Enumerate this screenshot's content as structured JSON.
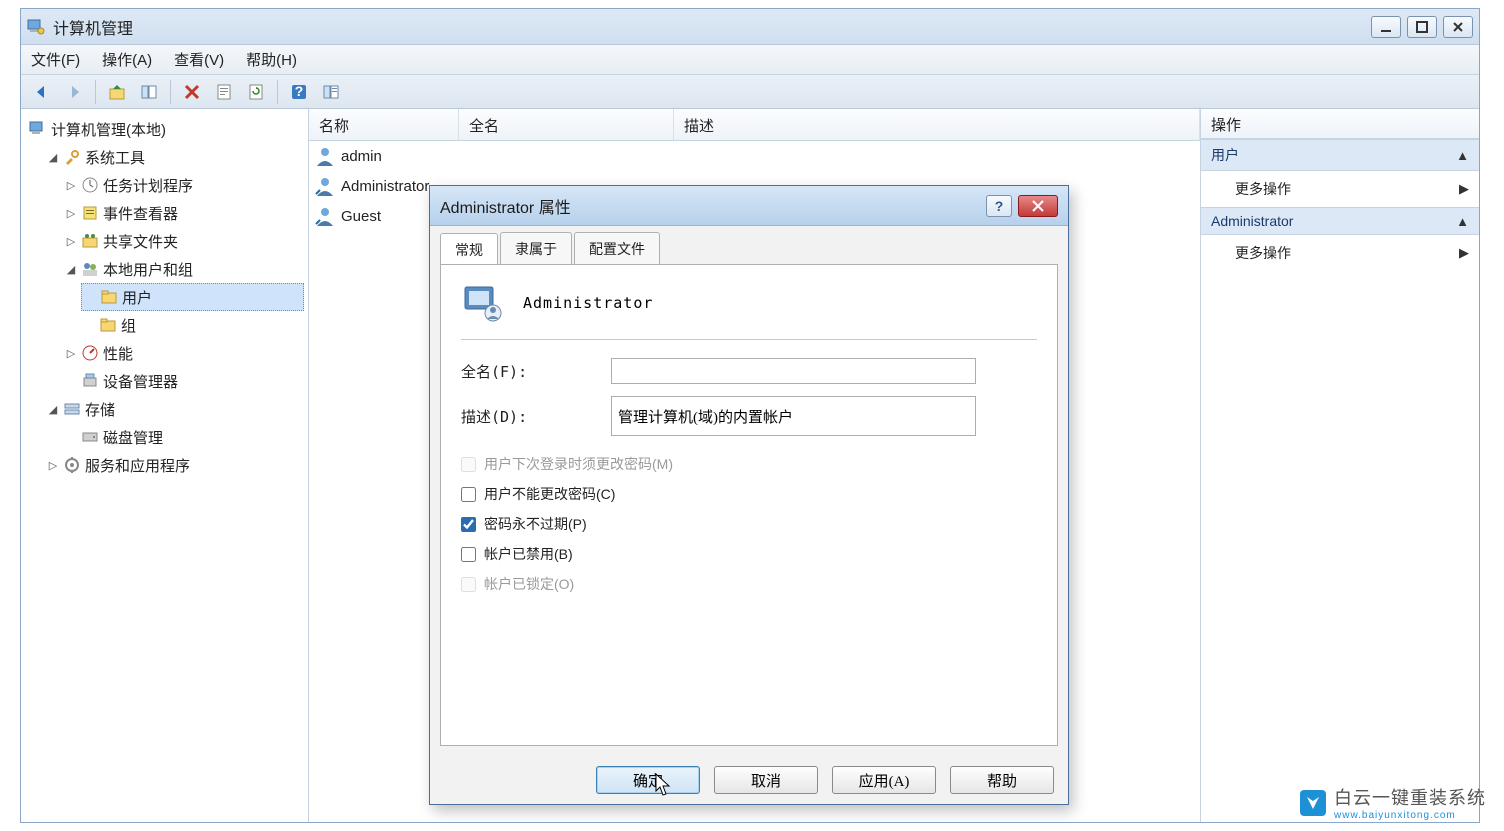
{
  "window": {
    "title": "计算机管理"
  },
  "menus": {
    "file": "文件(F)",
    "action": "操作(A)",
    "view": "查看(V)",
    "help": "帮助(H)"
  },
  "tree": {
    "root": "计算机管理(本地)",
    "system_tools": "系统工具",
    "task_scheduler": "任务计划程序",
    "event_viewer": "事件查看器",
    "shared_folders": "共享文件夹",
    "local_users": "本地用户和组",
    "users": "用户",
    "groups": "组",
    "performance": "性能",
    "device_manager": "设备管理器",
    "storage": "存储",
    "disk_management": "磁盘管理",
    "services": "服务和应用程序"
  },
  "list": {
    "headers": {
      "name": "名称",
      "full": "全名",
      "desc": "描述"
    },
    "rows": [
      {
        "name": "admin"
      },
      {
        "name": "Administrator"
      },
      {
        "name": "Guest"
      }
    ]
  },
  "actions": {
    "header": "操作",
    "group1": "用户",
    "more1": "更多操作",
    "group2": "Administrator",
    "more2": "更多操作"
  },
  "dialog": {
    "title": "Administrator 属性",
    "account_name": "Administrator",
    "tabs": {
      "general": "常规",
      "memberof": "隶属于",
      "profile": "配置文件"
    },
    "labels": {
      "fullname": "全名(F):",
      "desc": "描述(D):"
    },
    "fields": {
      "fullname": "",
      "desc": "管理计算机(域)的内置帐户"
    },
    "checks": {
      "must_change": "用户下次登录时须更改密码(M)",
      "cannot_change": "用户不能更改密码(C)",
      "never_expire": "密码永不过期(P)",
      "disabled": "帐户已禁用(B)",
      "locked": "帐户已锁定(O)"
    },
    "buttons": {
      "ok": "确定",
      "cancel": "取消",
      "apply": "应用(A)",
      "help": "帮助"
    }
  },
  "watermark": {
    "main": "白云一键重装系统",
    "sub": "www.baiyunxitong.com"
  }
}
